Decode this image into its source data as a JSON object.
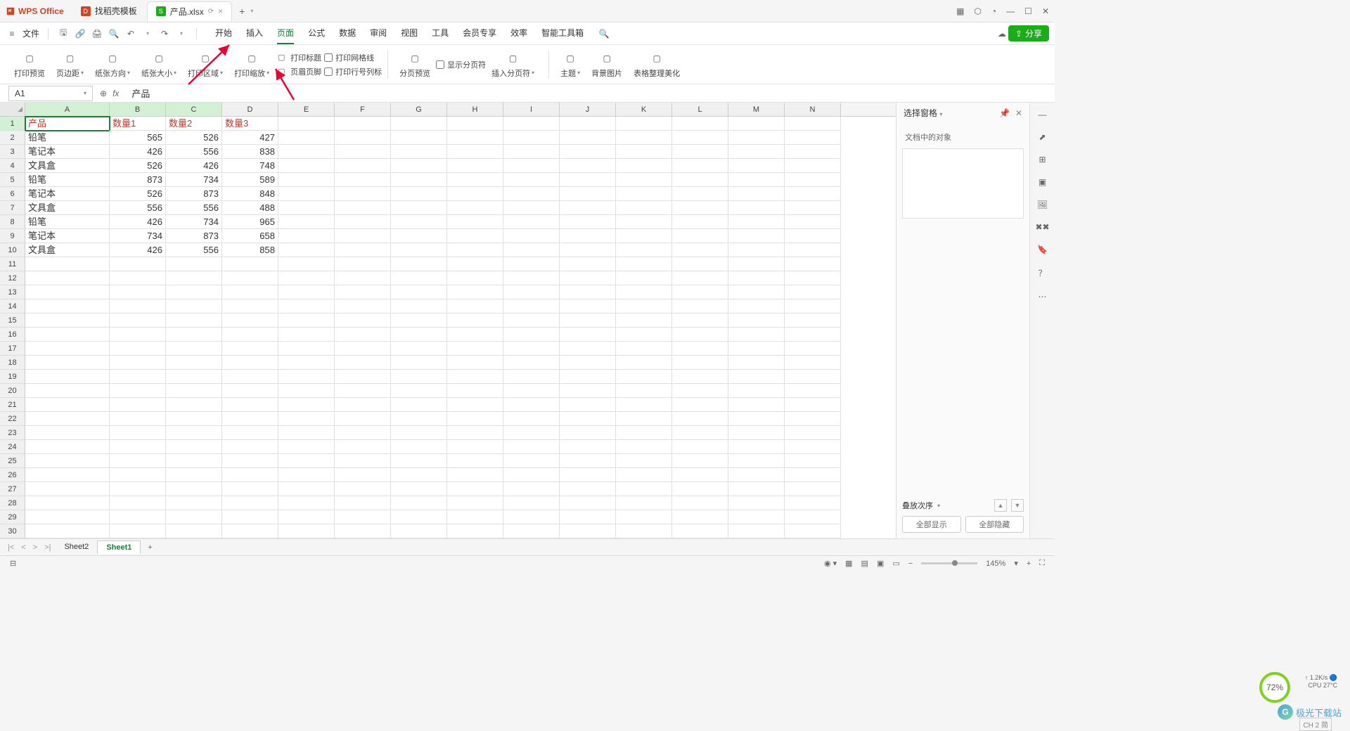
{
  "app": {
    "name": "WPS Office"
  },
  "tabs": [
    {
      "icon": "red",
      "label": "找稻壳模板"
    },
    {
      "icon": "green",
      "label": "产品.xlsx",
      "active": true
    }
  ],
  "menu": {
    "file": "文件",
    "items": [
      "开始",
      "插入",
      "页面",
      "公式",
      "数据",
      "审阅",
      "视图",
      "工具",
      "会员专享",
      "效率",
      "智能工具箱"
    ],
    "active_index": 2,
    "share": "分享"
  },
  "ribbon": {
    "items": [
      {
        "label": "打印预览"
      },
      {
        "label": "页边距",
        "dd": true
      },
      {
        "label": "纸张方向",
        "dd": true
      },
      {
        "label": "纸张大小",
        "dd": true
      },
      {
        "label": "打印区域",
        "dd": true
      },
      {
        "label": "打印缩放",
        "dd": true
      }
    ],
    "col1": [
      {
        "label": "打印标题",
        "check": false,
        "ic": true
      },
      {
        "label": "页眉页脚",
        "check": false,
        "ic": true
      }
    ],
    "col2": [
      {
        "label": "打印网格线",
        "check": true
      },
      {
        "label": "打印行号列标",
        "check": true
      }
    ],
    "items2": [
      {
        "label": "分页预览"
      },
      {
        "label": "插入分页符",
        "dd": true
      }
    ],
    "col3": [
      {
        "label": "显示分页符",
        "check": true
      }
    ],
    "items3": [
      {
        "label": "主题",
        "dd": true
      },
      {
        "label": "背景图片"
      },
      {
        "label": "表格整理美化"
      }
    ]
  },
  "formula": {
    "cell_ref": "A1",
    "value": "产品"
  },
  "grid": {
    "columns": [
      "A",
      "B",
      "C",
      "D",
      "E",
      "F",
      "G",
      "H",
      "I",
      "J",
      "K",
      "L",
      "M",
      "N"
    ],
    "selected_cols": [
      0,
      1,
      2
    ],
    "header_row": [
      "产品",
      "数量1",
      "数量2",
      "数量3"
    ],
    "data": [
      [
        "铅笔",
        565,
        526,
        427
      ],
      [
        "笔记本",
        426,
        556,
        838
      ],
      [
        "文具盒",
        526,
        426,
        748
      ],
      [
        "铅笔",
        873,
        734,
        589
      ],
      [
        "笔记本",
        526,
        873,
        848
      ],
      [
        "文具盒",
        556,
        556,
        488
      ],
      [
        "铅笔",
        426,
        734,
        965
      ],
      [
        "笔记本",
        734,
        873,
        658
      ],
      [
        "文具盒",
        426,
        556,
        858
      ]
    ],
    "row_count": 30
  },
  "right_panel": {
    "title": "选择窗格",
    "subtitle": "文档中的对象",
    "stack_label": "叠放次序",
    "show_all": "全部显示",
    "hide_all": "全部隐藏"
  },
  "sheets": {
    "list": [
      "Sheet2",
      "Sheet1"
    ],
    "active_index": 1
  },
  "status": {
    "zoom": "145%"
  },
  "floating": {
    "perf": "72%",
    "net": "1.2K/s",
    "cpu": "CPU 27°C",
    "watermark": "极光下载站",
    "ime": "CH 2 简"
  }
}
